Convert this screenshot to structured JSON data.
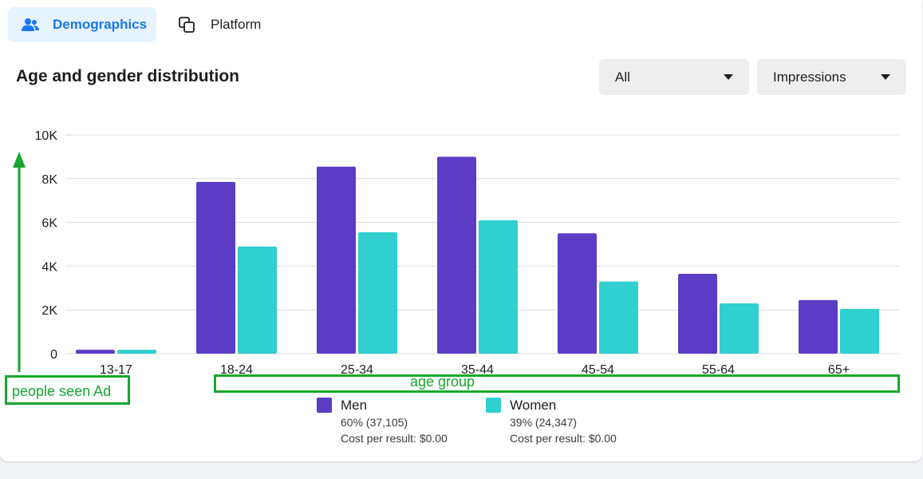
{
  "tabs": [
    {
      "label": "Demographics",
      "icon": "people-icon"
    },
    {
      "label": "Platform",
      "icon": "copy-icon"
    }
  ],
  "section_title": "Age and gender distribution",
  "filters": {
    "audience": "All",
    "metric": "Impressions"
  },
  "legend": [
    {
      "name": "Men",
      "share": "60% (37,105)",
      "cost": "Cost per result: $0.00",
      "color": "#5b3cc4"
    },
    {
      "name": "Women",
      "share": "39% (24,347)",
      "cost": "Cost per result: $0.00",
      "color": "#31cfcf"
    }
  ],
  "annotations": {
    "y_axis_note": "people seen Ad",
    "x_axis_note": "age group",
    "color": "#16a72e"
  },
  "chart_data": {
    "type": "bar",
    "title": "Age and gender distribution",
    "categories": [
      "13-17",
      "18-24",
      "25-34",
      "35-44",
      "45-54",
      "55-64",
      "65+"
    ],
    "series": [
      {
        "name": "Men",
        "values": [
          180,
          7850,
          8550,
          9000,
          5500,
          3650,
          2450
        ]
      },
      {
        "name": "Women",
        "values": [
          180,
          4900,
          5550,
          6100,
          3300,
          2300,
          2050
        ]
      }
    ],
    "yticks": [
      0,
      2000,
      4000,
      6000,
      8000,
      10000
    ],
    "ytick_labels": [
      "0",
      "2K",
      "4K",
      "6K",
      "8K",
      "10K"
    ],
    "ylim": [
      0,
      10000
    ],
    "grid": true,
    "legend_position": "bottom"
  }
}
